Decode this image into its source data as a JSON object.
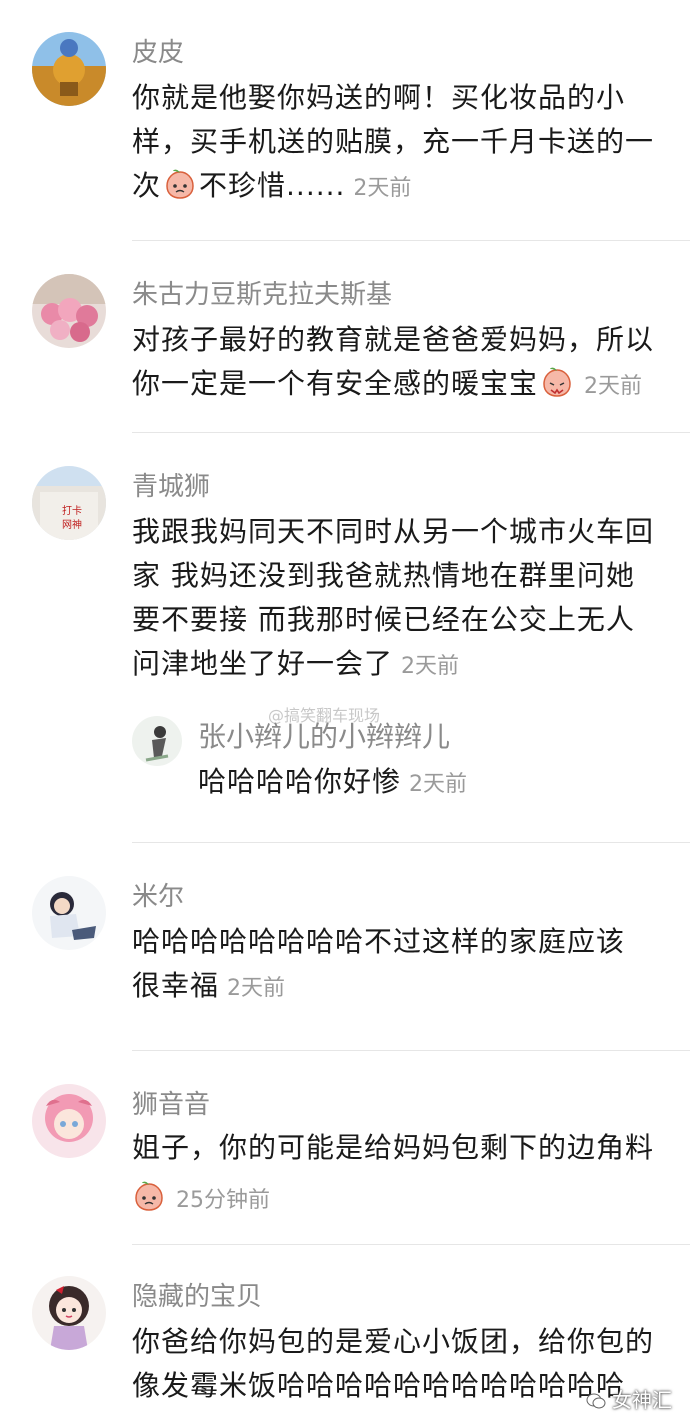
{
  "comments": [
    {
      "user": "皮皮",
      "lines": [
        "你就是他娶你妈送的啊！买化妆品的小",
        "样，买手机送的贴膜，充一千月卡送的一"
      ],
      "last_before": "次",
      "last_after": "不珍惜......",
      "time": "2天前",
      "emoji": "peach-face-emoji"
    },
    {
      "user": "朱古力豆斯克拉夫斯基",
      "lines": [
        "对孩子最好的教育就是爸爸爱妈妈，所以"
      ],
      "last_before": "你一定是一个有安全感的暖宝宝",
      "last_after": "",
      "time": "2天前",
      "emoji": "peach-bow-emoji"
    },
    {
      "user": "青城狮",
      "lines": [
        "我跟我妈同天不同时从另一个城市火车回",
        "家 我妈还没到我爸就热情地在群里问她",
        "要不要接 而我那时候已经在公交上无人"
      ],
      "last_before": "问津地坐了好一会了",
      "last_after": "",
      "time": "2天前",
      "reply": {
        "user": "张小辫儿的小辫辫儿",
        "text": "哈哈哈哈你好惨",
        "time": "2天前"
      }
    },
    {
      "user": "米尔",
      "lines": [
        "哈哈哈哈哈哈哈哈不过这样的家庭应该"
      ],
      "last_before": "很幸福",
      "last_after": "",
      "time": "2天前"
    },
    {
      "user": "狮音音",
      "lines": [
        "姐子，你的可能是给妈妈包剩下的边角料"
      ],
      "last_before": "",
      "last_after": "",
      "time": "25分钟前",
      "emoji": "peach-face-emoji"
    },
    {
      "user": "隐藏的宝贝",
      "lines": [
        "你爸给你妈包的是爱心小饭团，给你包的",
        "像发霉米饭哈哈哈哈哈哈哈哈哈哈哈哈"
      ],
      "last_before": "",
      "last_after": ""
    }
  ],
  "watermark_mid": "@搞笑翻车现场",
  "watermark_corner": "女神汇",
  "colors": {
    "username": "#8a8a8a",
    "text": "#1a1a1a",
    "time": "#9a9a9a",
    "divider": "#e6e6e6"
  }
}
